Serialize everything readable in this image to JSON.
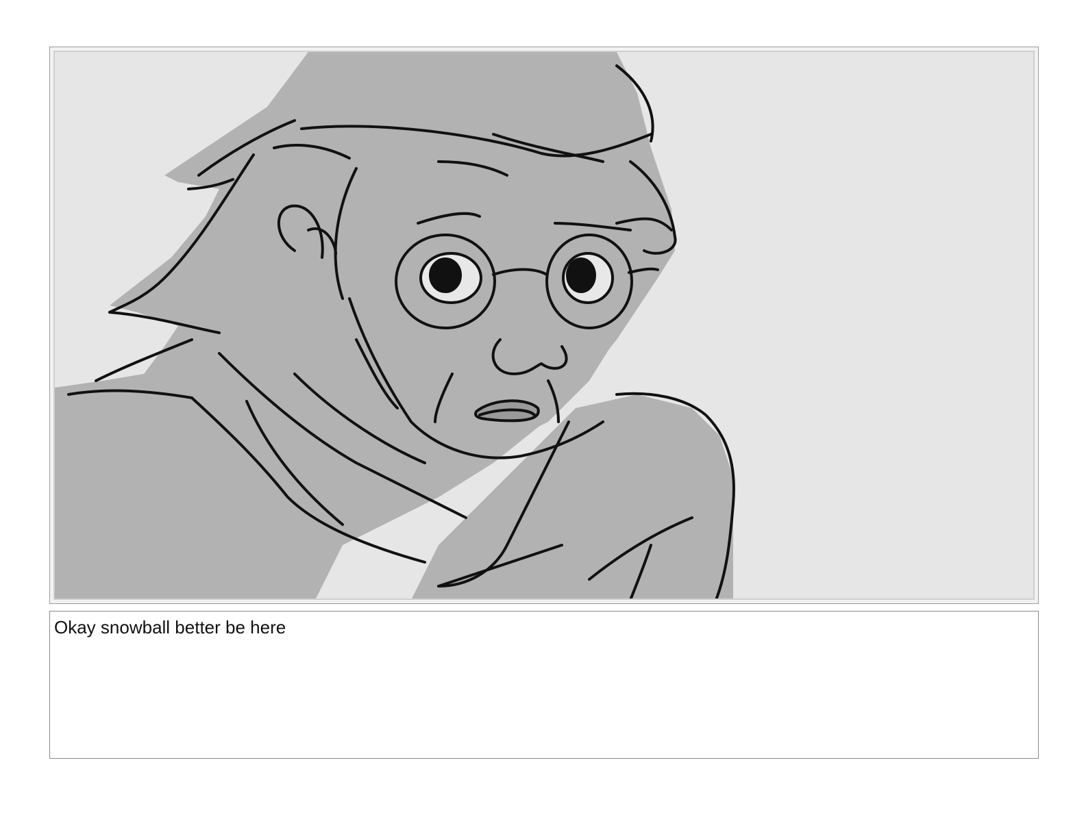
{
  "storyboard": {
    "panel": {
      "content": "character-sketch"
    },
    "caption": {
      "text": "Okay snowball better be here"
    }
  }
}
